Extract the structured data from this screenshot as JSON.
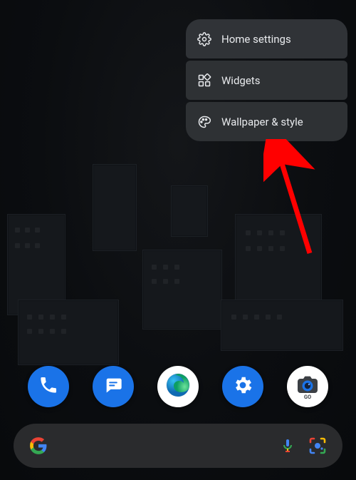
{
  "context_menu": {
    "items": [
      {
        "label": "Home settings",
        "icon": "gear-icon"
      },
      {
        "label": "Widgets",
        "icon": "widgets-icon"
      },
      {
        "label": "Wallpaper & style",
        "icon": "palette-icon"
      }
    ]
  },
  "dock": {
    "apps": [
      {
        "name": "Phone",
        "icon": "phone-icon",
        "bg": "#1a73e8"
      },
      {
        "name": "Messages",
        "icon": "messages-icon",
        "bg": "#1a73e8"
      },
      {
        "name": "Edge",
        "icon": "edge-icon",
        "bg": "#ffffff"
      },
      {
        "name": "Settings",
        "icon": "settings-icon",
        "bg": "#1a73e8"
      },
      {
        "name": "Camera Go",
        "icon": "camera-icon",
        "bg": "#ffffff",
        "badge": "GO"
      }
    ]
  },
  "search": {
    "logo": "google-logo",
    "mic": "mic-icon",
    "lens": "lens-icon"
  },
  "annotation": {
    "target": "Wallpaper & style",
    "color": "#ff0000"
  }
}
